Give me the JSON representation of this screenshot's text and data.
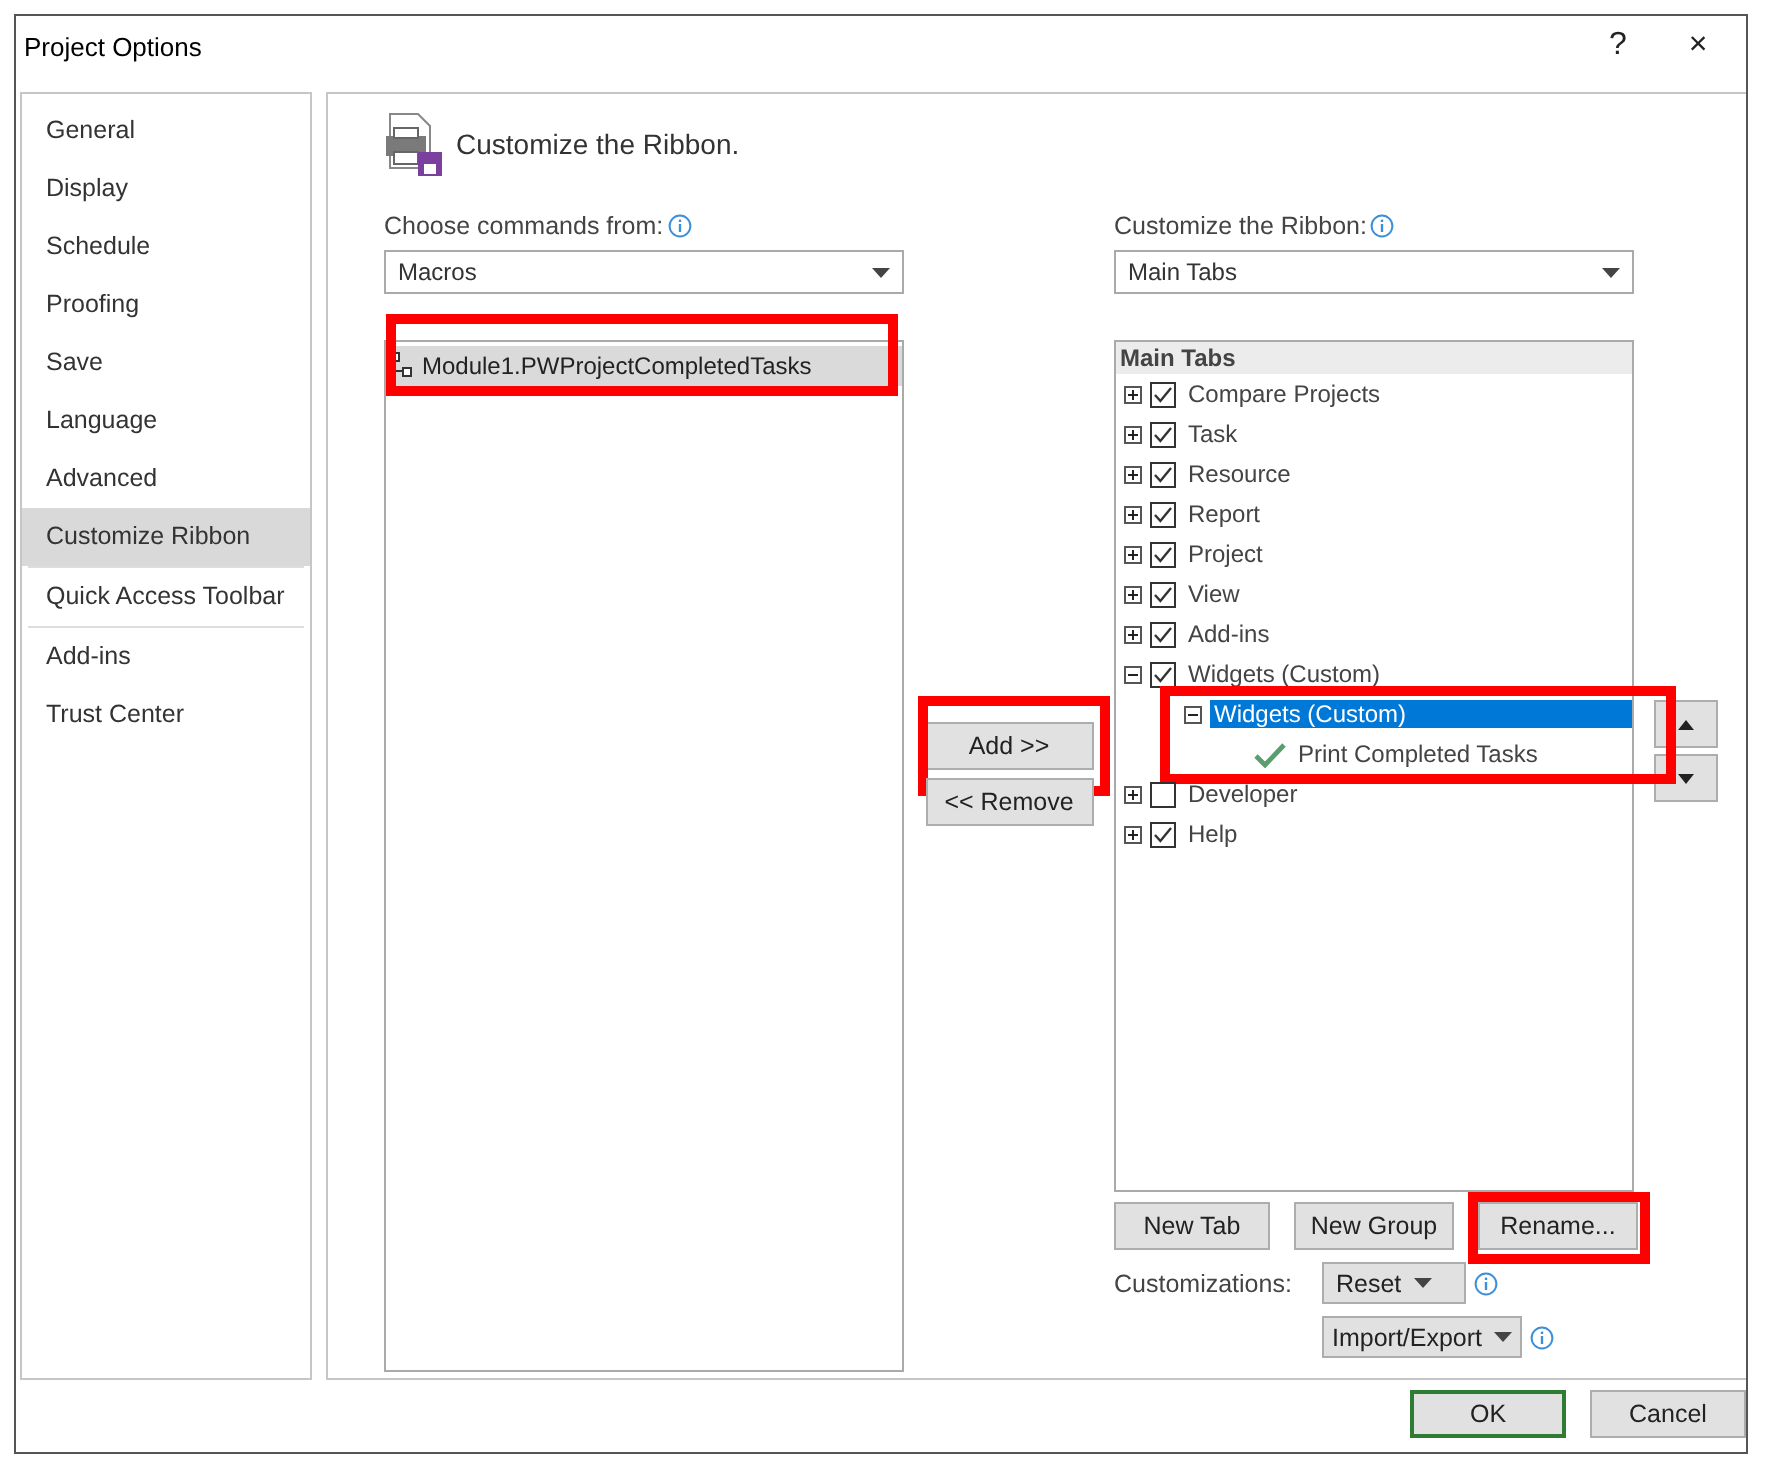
{
  "window": {
    "title": "Project Options",
    "help": "?",
    "close": "×"
  },
  "sidebar": {
    "groups": [
      [
        {
          "label": "General",
          "selected": false
        },
        {
          "label": "Display",
          "selected": false
        },
        {
          "label": "Schedule",
          "selected": false
        },
        {
          "label": "Proofing",
          "selected": false
        },
        {
          "label": "Save",
          "selected": false
        },
        {
          "label": "Language",
          "selected": false
        },
        {
          "label": "Advanced",
          "selected": false
        },
        {
          "label": "Customize Ribbon",
          "selected": true
        }
      ],
      [
        {
          "label": "Quick Access Toolbar",
          "selected": false
        }
      ],
      [
        {
          "label": "Add-ins",
          "selected": false
        },
        {
          "label": "Trust Center",
          "selected": false
        }
      ]
    ]
  },
  "header": "Customize the Ribbon.",
  "commands": {
    "label": "Choose commands from:",
    "dropdown": "Macros",
    "items": [
      {
        "label": "Module1.PWProjectCompletedTasks",
        "selected": true,
        "highlighted": true
      }
    ]
  },
  "middle_buttons": [
    {
      "label": "Add >>",
      "highlighted": true
    },
    {
      "label": "<< Remove",
      "highlighted": false
    }
  ],
  "ribbon": {
    "label": "Customize the Ribbon:",
    "dropdown": "Main Tabs",
    "heading": "Main Tabs",
    "items": [
      {
        "kind": "tab",
        "label": "Compare Projects",
        "checked": true,
        "expanded": false
      },
      {
        "kind": "tab",
        "label": "Task",
        "checked": true,
        "expanded": false
      },
      {
        "kind": "tab",
        "label": "Resource",
        "checked": true,
        "expanded": false
      },
      {
        "kind": "tab",
        "label": "Report",
        "checked": true,
        "expanded": false
      },
      {
        "kind": "tab",
        "label": "Project",
        "checked": true,
        "expanded": false
      },
      {
        "kind": "tab",
        "label": "View",
        "checked": true,
        "expanded": false
      },
      {
        "kind": "tab",
        "label": "Add-ins",
        "checked": true,
        "expanded": false
      },
      {
        "kind": "tab",
        "label": "Widgets (Custom)",
        "checked": true,
        "expanded": true,
        "children": [
          {
            "kind": "group",
            "label": "Widgets (Custom)",
            "expanded": true,
            "selected": true,
            "highlighted": true,
            "children": [
              {
                "kind": "command",
                "label": "Print Completed Tasks"
              }
            ]
          }
        ]
      },
      {
        "kind": "tab",
        "label": "Developer",
        "checked": false,
        "expanded": false
      },
      {
        "kind": "tab",
        "label": "Help",
        "checked": true,
        "expanded": false
      }
    ]
  },
  "tree_buttons": [
    {
      "label": "New Tab",
      "highlighted": false
    },
    {
      "label": "New Group",
      "highlighted": false
    },
    {
      "label": "Rename...",
      "highlighted": true
    }
  ],
  "customizations": {
    "label": "Customizations:",
    "reset": "Reset",
    "import_export": "Import/Export"
  },
  "footer_buttons": [
    {
      "label": "OK",
      "default": true
    },
    {
      "label": "Cancel",
      "default": false
    }
  ]
}
